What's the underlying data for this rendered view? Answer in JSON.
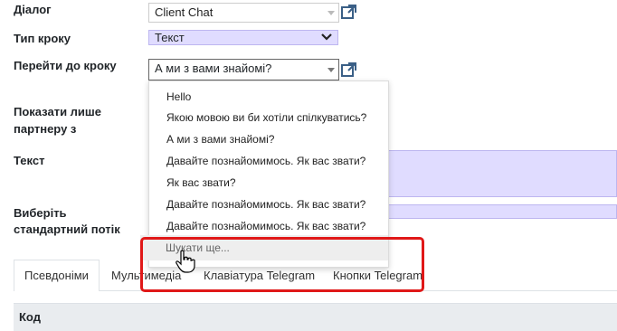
{
  "form": {
    "dialog_label": "Діалог",
    "dialog_value": "Client Chat",
    "step_type_label": "Тип кроку",
    "step_type_value": "Текст",
    "goto_label": "Перейти до кроку",
    "goto_value": "А ми з вами знайомі?",
    "show_partner_label_1": "Показати лише",
    "show_partner_label_2": "партнеру з",
    "text_label": "Текст",
    "flow_label_1": "Виберіть",
    "flow_label_2": "стандартний потік"
  },
  "dropdown": {
    "items": [
      "Hello",
      "Якою мовою ви би хотіли спілкуватись?",
      "А ми з вами знайомі?",
      "Давайте познайомимось. Як вас звати?",
      "Як вас звати?",
      "Давайте познайомимось. Як вас звати?",
      "Давайте познайомимось. Як вас звати?"
    ],
    "search_more": "Шукати ще..."
  },
  "tabs": [
    "Псевдоніми",
    "Мультимедіа",
    "Клавіатура Telegram",
    "Кнопки Telegram"
  ],
  "table": {
    "header_code": "Код"
  },
  "colors": {
    "purple_fill": "#e0dcff",
    "highlight": "#e01818",
    "link_icon": "#3a5f86"
  }
}
